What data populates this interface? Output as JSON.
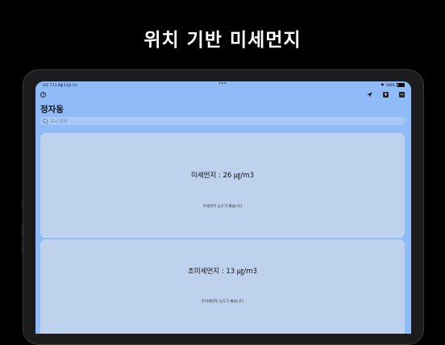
{
  "headline": "위치 기반 미세먼지",
  "status_bar": {
    "time_date": "오후 7:11  6월 11일 (수)",
    "battery": "100%"
  },
  "location_title": "정자동",
  "search": {
    "placeholder": "도시 검색"
  },
  "cards": [
    {
      "value": "미세먼지 : 26 ㎍/m3",
      "description": "미세먼지 농도가 좋습니다"
    },
    {
      "value": "초미세먼지 : 13 ㎍/m3",
      "description": "초미세먼지 농도가 좋습니다"
    }
  ],
  "icons": {
    "top_left": "play-circle-icon",
    "location": "location-arrow-icon",
    "add": "plus-square-icon",
    "menu": "minus-square-icon"
  },
  "colors": {
    "screen_bg": "#8fbcf9",
    "card_bg": "#bed2ee",
    "page_bg": "#000000"
  }
}
